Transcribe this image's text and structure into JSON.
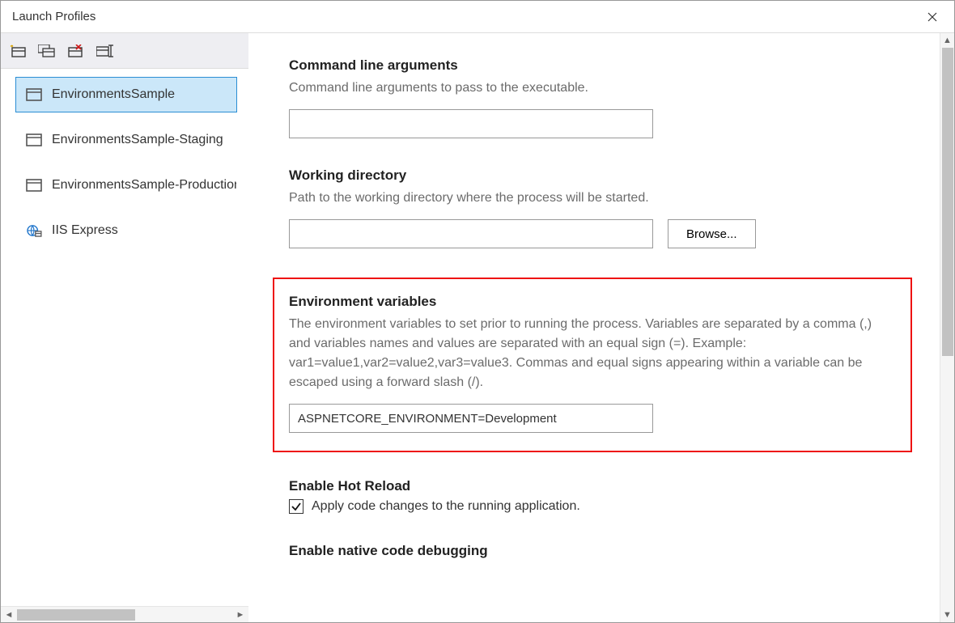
{
  "window": {
    "title": "Launch Profiles"
  },
  "sidebar": {
    "items": [
      {
        "label": "EnvironmentsSample",
        "icon": "app",
        "selected": true
      },
      {
        "label": "EnvironmentsSample-Staging",
        "icon": "app",
        "selected": false
      },
      {
        "label": "EnvironmentsSample-Production",
        "icon": "app",
        "selected": false
      },
      {
        "label": "IIS Express",
        "icon": "iis",
        "selected": false
      }
    ]
  },
  "sections": {
    "cmdline": {
      "title": "Command line arguments",
      "desc": "Command line arguments to pass to the executable.",
      "value": ""
    },
    "workdir": {
      "title": "Working directory",
      "desc": "Path to the working directory where the process will be started.",
      "value": "",
      "browse_label": "Browse..."
    },
    "envvars": {
      "title": "Environment variables",
      "desc": "The environment variables to set prior to running the process. Variables are separated by a comma (,) and variables names and values are separated with an equal sign (=). Example: var1=value1,var2=value2,var3=value3. Commas and equal signs appearing within a variable can be escaped using a forward slash (/).",
      "value": "ASPNETCORE_ENVIRONMENT=Development"
    },
    "hotreload": {
      "title": "Enable Hot Reload",
      "checkbox_label": "Apply code changes to the running application.",
      "checked": true
    },
    "nativedebug": {
      "title": "Enable native code debugging"
    }
  }
}
